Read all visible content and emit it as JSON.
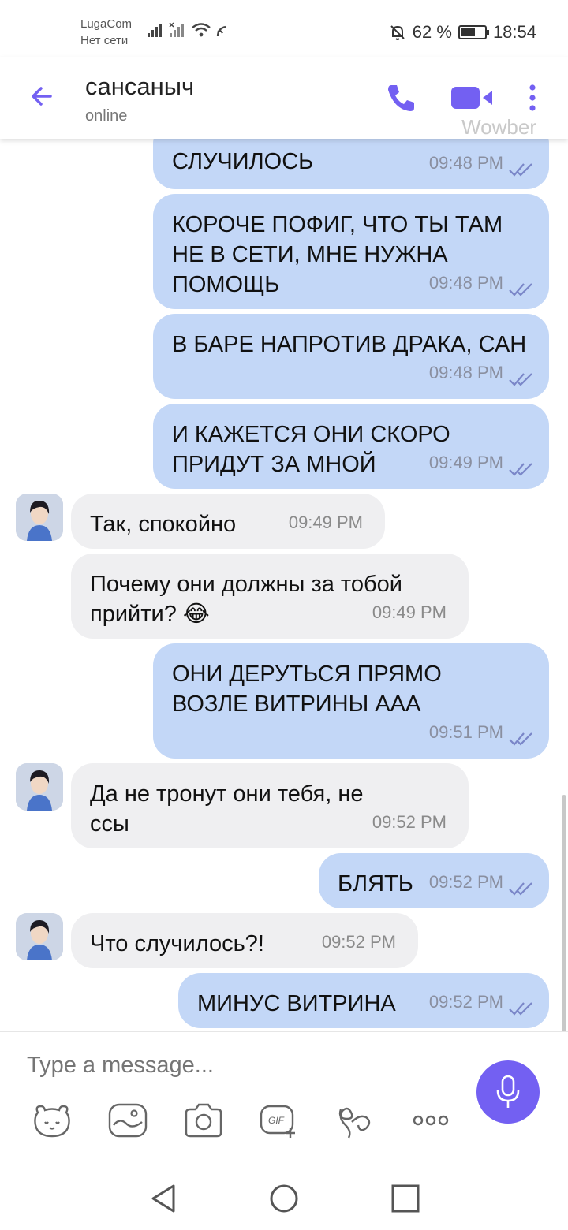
{
  "status_bar": {
    "carrier_line1": "LugaCom",
    "carrier_line2": "Нет сети",
    "battery": "62 %",
    "time": "18:54",
    "battery_level": 0.62
  },
  "header": {
    "contact_name": "сансаныч",
    "status": "online",
    "watermark": "Wowber"
  },
  "messages": [
    {
      "dir": "out",
      "text": "СЛУЧИЛОСЬ",
      "time": "09:48 PM"
    },
    {
      "dir": "out",
      "text": "КОРОЧЕ ПОФИГ, ЧТО ТЫ ТАМ НЕ В СЕТИ, МНЕ НУЖНА ПОМОЩЬ",
      "time": "09:48 PM"
    },
    {
      "dir": "out",
      "text": "В БАРЕ НАПРОТИВ ДРАКА, САН",
      "time": "09:48 PM"
    },
    {
      "dir": "out",
      "text": "И КАЖЕТСЯ ОНИ СКОРО ПРИДУТ ЗА МНОЙ",
      "time": "09:49 PM"
    },
    {
      "dir": "in",
      "text": "Так, спокойно",
      "time": "09:49 PM"
    },
    {
      "dir": "in",
      "text": "Почему они должны за тобой прийти? 😂",
      "time": "09:49 PM"
    },
    {
      "dir": "out",
      "text": "ОНИ ДЕРУТЬСЯ ПРЯМО ВОЗЛЕ ВИТРИНЫ ААА",
      "time": "09:51 PM"
    },
    {
      "dir": "in",
      "text": "Да не тронут они тебя, не ссы",
      "time": "09:52 PM"
    },
    {
      "dir": "out",
      "text": "БЛЯТЬ",
      "time": "09:52 PM"
    },
    {
      "dir": "in",
      "text": "Что случилось?!",
      "time": "09:52 PM"
    },
    {
      "dir": "out",
      "text": "МИНУС ВИТРИНА",
      "time": "09:52 PM"
    }
  ],
  "composer": {
    "placeholder": "Type a message..."
  },
  "colors": {
    "accent": "#7360f2",
    "outgoing_bubble": "#c3d7f7",
    "incoming_bubble": "#efeff1"
  }
}
